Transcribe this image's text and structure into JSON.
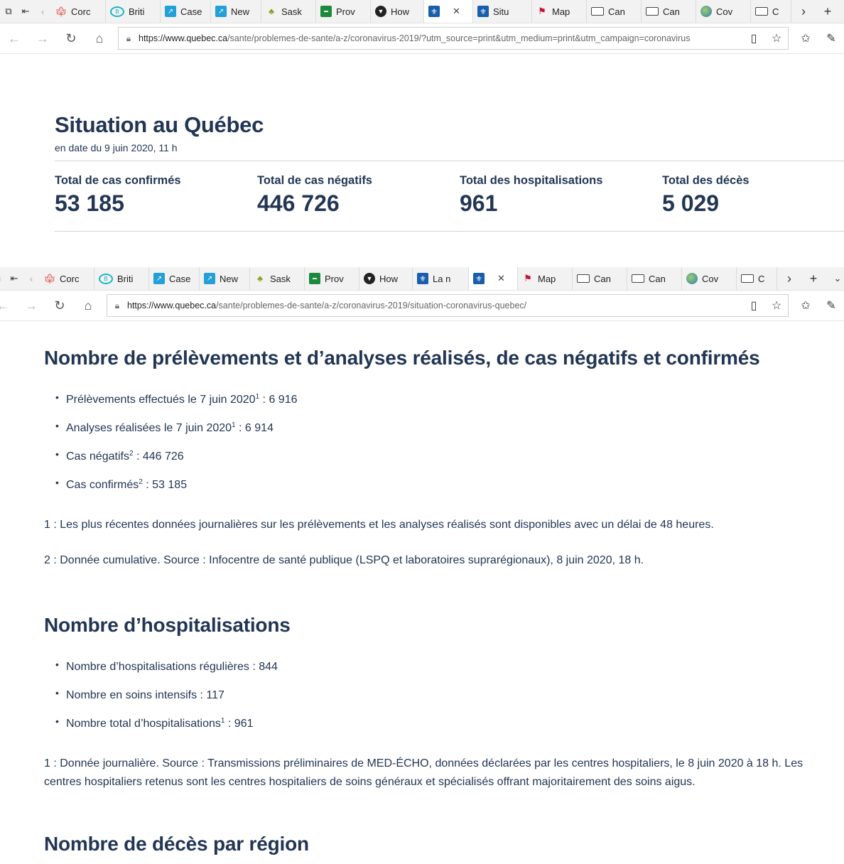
{
  "window1": {
    "tabs": [
      {
        "label": "Corc",
        "icon": "maple-leaf-icon"
      },
      {
        "label": "Briti",
        "icon": "bc-icon"
      },
      {
        "label": "Case",
        "icon": "chart-icon"
      },
      {
        "label": "New",
        "icon": "chart-icon"
      },
      {
        "label": "Sask",
        "icon": "sask-icon"
      },
      {
        "label": "Prov",
        "icon": "green-icon"
      },
      {
        "label": "How",
        "icon": "dark-circle-icon"
      },
      {
        "label": "",
        "icon": "quebec-icon",
        "active": true
      },
      {
        "label": "Situ",
        "icon": "quebec-icon"
      },
      {
        "label": "Map",
        "icon": "red-icon"
      },
      {
        "label": "Can",
        "icon": "window-icon"
      },
      {
        "label": "Can",
        "icon": "window-icon"
      },
      {
        "label": "Cov",
        "icon": "globe-icon"
      },
      {
        "label": "C",
        "icon": "window-icon"
      }
    ],
    "url_host": "https://www.quebec.ca",
    "url_path": "/sante/problemes-de-sante/a-z/coronavirus-2019/?utm_source=print&utm_medium=print&utm_campaign=coronavirus",
    "title": "Situation au Québec",
    "date": "en date du 9 juin 2020, 11 h",
    "stats": [
      {
        "label": "Total de cas confirmés",
        "value": "53 185"
      },
      {
        "label": "Total de cas négatifs",
        "value": "446 726"
      },
      {
        "label": "Total des hospitalisations",
        "value": "961"
      },
      {
        "label": "Total des décès",
        "value": "5 029"
      }
    ]
  },
  "window2": {
    "tabs": [
      {
        "label": "Corc",
        "icon": "maple-leaf-icon"
      },
      {
        "label": "Briti",
        "icon": "bc-icon"
      },
      {
        "label": "Case",
        "icon": "chart-icon"
      },
      {
        "label": "New",
        "icon": "chart-icon"
      },
      {
        "label": "Sask",
        "icon": "sask-icon"
      },
      {
        "label": "Prov",
        "icon": "green-icon"
      },
      {
        "label": "How",
        "icon": "dark-circle-icon"
      },
      {
        "label": "La n",
        "icon": "quebec-icon"
      },
      {
        "label": "",
        "icon": "quebec-icon",
        "active": true
      },
      {
        "label": "Map",
        "icon": "red-icon"
      },
      {
        "label": "Can",
        "icon": "window-icon"
      },
      {
        "label": "Can",
        "icon": "window-icon"
      },
      {
        "label": "Cov",
        "icon": "globe-icon"
      },
      {
        "label": "C",
        "icon": "window-icon"
      }
    ],
    "url_host": "https://www.quebec.ca",
    "url_path": "/sante/problemes-de-sante/a-z/coronavirus-2019/situation-coronavirus-quebec/",
    "section1": {
      "heading": "Nombre de prélèvements et d’analyses réalisés, de cas négatifs et confirmés",
      "items": [
        {
          "text": "Prélèvements effectués le 7 juin 2020",
          "sup": "1",
          "value": " : 6 916"
        },
        {
          "text": "Analyses réalisées le 7 juin 2020",
          "sup": "1",
          "value": " : 6 914"
        },
        {
          "text": "Cas négatifs",
          "sup": "2",
          "value": " : 446 726"
        },
        {
          "text": "Cas confirmés",
          "sup": "2",
          "value": " : 53 185"
        }
      ],
      "note1": "1 : Les plus récentes données journalières sur les prélèvements et les analyses réalisés sont disponibles avec un délai de 48 heures.",
      "note2": "2 : Donnée cumulative. Source : Infocentre de santé publique (LSPQ et laboratoires suprarégionaux), 8 juin 2020, 18 h."
    },
    "section2": {
      "heading": "Nombre d’hospitalisations",
      "items": [
        {
          "text": "Nombre d’hospitalisations régulières",
          "sup": "",
          "value": " : 844"
        },
        {
          "text": "Nombre en soins intensifs",
          "sup": "",
          "value": " : 117"
        },
        {
          "text": "Nombre total d’hospitalisations",
          "sup": "1",
          "value": " : 961"
        }
      ],
      "note1": "1 : Donnée journalière. Source : Transmissions préliminaires de MED-ÉCHO, données déclarées par les centres hospitaliers, le 8 juin 2020 à 18 h. Les centres hospitaliers retenus sont les centres hospitaliers de soins généraux et spécialisés offrant majoritairement des soins aigus."
    },
    "section3": {
      "heading": "Nombre de décès par région"
    }
  }
}
